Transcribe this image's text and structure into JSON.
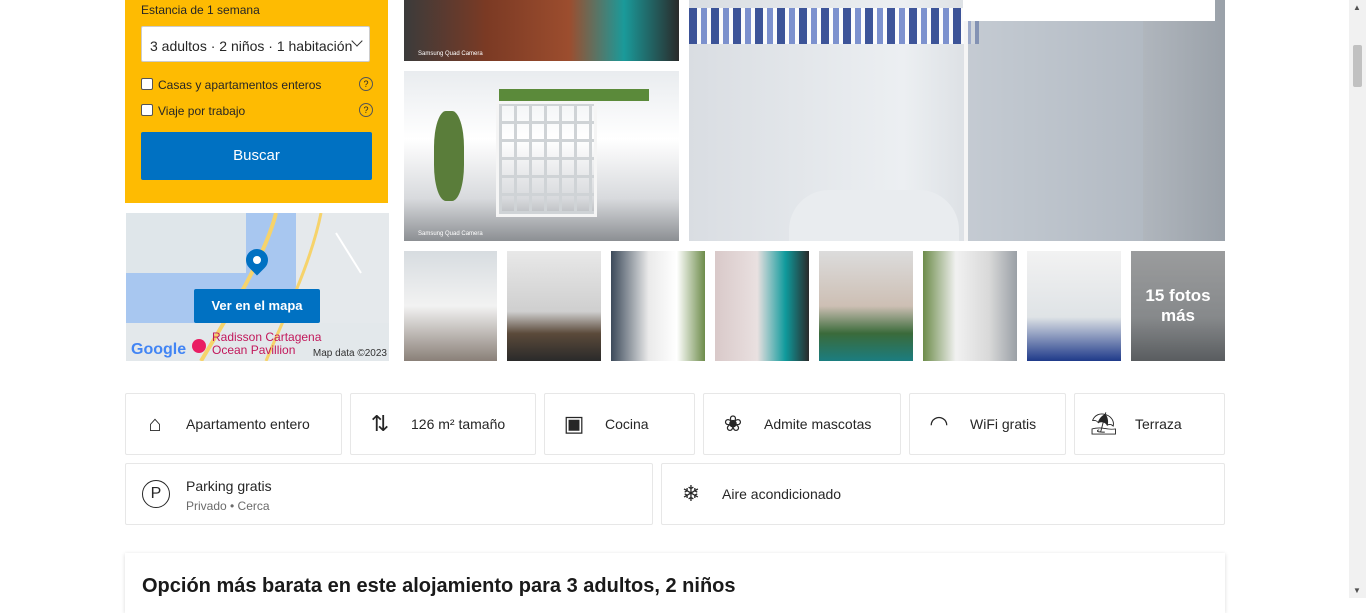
{
  "search": {
    "stay_label": "Estancia de 1 semana",
    "occupancy_value": "3 adultos · 2 niños · 1 habitación",
    "checkbox_homes": "Casas y apartamentos enteros",
    "checkbox_work": "Viaje por trabajo",
    "help_glyph": "?",
    "button_label": "Buscar"
  },
  "map": {
    "button_label": "Ver en el mapa",
    "hotel_name_line1": "Radisson Cartagena",
    "hotel_name_line2": "Ocean Pavillion",
    "google_logo": "Google",
    "attribution": "Map data ©2023"
  },
  "gallery": {
    "camera_caption": "Samsung Quad Camera",
    "more_photos": "15 fotos más"
  },
  "facilities": [
    {
      "label": "Apartamento entero",
      "icon": "house-icon"
    },
    {
      "label": "126 m² tamaño",
      "icon": "size-icon"
    },
    {
      "label": "Cocina",
      "icon": "kitchen-icon"
    },
    {
      "label": "Admite mascotas",
      "icon": "paw-icon"
    },
    {
      "label": "WiFi gratis",
      "icon": "wifi-icon"
    },
    {
      "label": "Terraza",
      "icon": "terrace-icon"
    }
  ],
  "facilities_row2": [
    {
      "label": "Parking gratis",
      "sublabel": "Privado • Cerca",
      "icon": "parking-icon"
    },
    {
      "label": "Aire acondicionado",
      "icon": "snowflake-icon"
    }
  ],
  "cheapest": {
    "title": "Opción más barata en este alojamiento para 3 adultos, 2 niños"
  }
}
